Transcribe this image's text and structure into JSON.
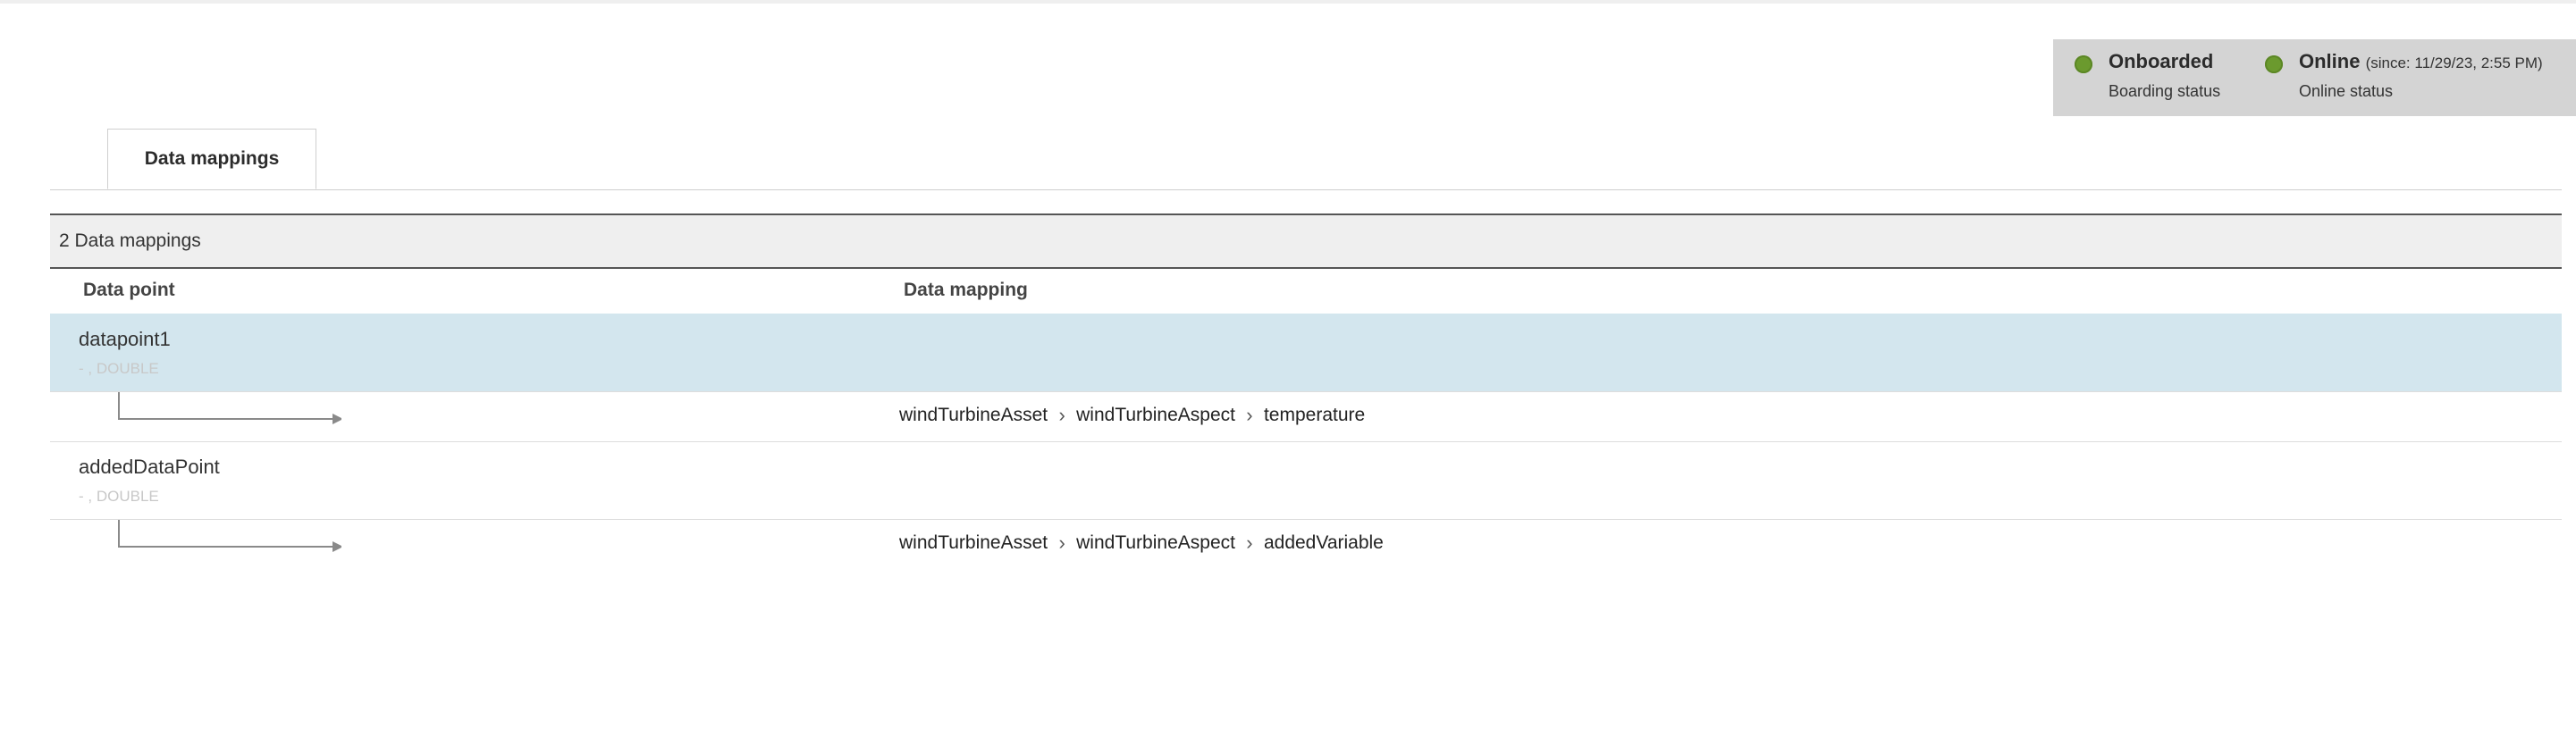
{
  "status": {
    "onboarded": {
      "title": "Onboarded",
      "sub": "Boarding status"
    },
    "online": {
      "title": "Online",
      "since": "(since: 11/29/23, 2:55 PM)",
      "sub": "Online status"
    },
    "dot_color": "#6b9a2e"
  },
  "tabs": [
    {
      "label": "Data mappings"
    }
  ],
  "table": {
    "count_label": "2 Data mappings",
    "columns": {
      "data_point": "Data point",
      "data_mapping": "Data mapping"
    },
    "rows": [
      {
        "name": "datapoint1",
        "sub": "- , DOUBLE",
        "mapping": {
          "asset": "windTurbineAsset",
          "aspect": "windTurbineAspect",
          "variable": "temperature"
        }
      },
      {
        "name": "addedDataPoint",
        "sub": "- , DOUBLE",
        "mapping": {
          "asset": "windTurbineAsset",
          "aspect": "windTurbineAspect",
          "variable": "addedVariable"
        }
      }
    ]
  },
  "colors": {
    "selected_row": "#d3e6ee",
    "header_bg": "#efefef",
    "status_panel": "#d4d4d4"
  },
  "icons": {
    "status": "status-dot-icon",
    "connector": "arrow-connector-icon",
    "separator": "chevron-right-icon"
  }
}
